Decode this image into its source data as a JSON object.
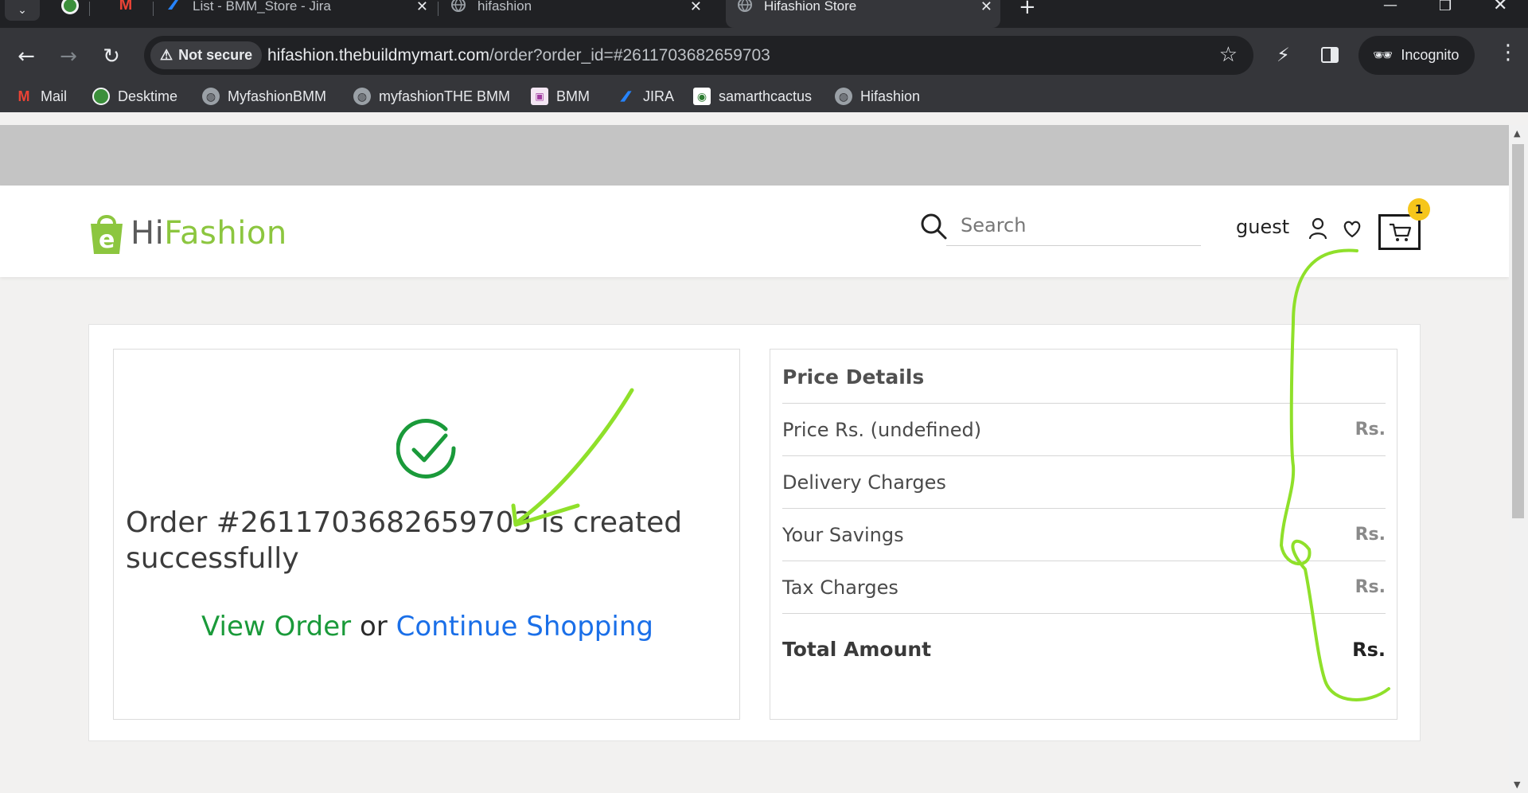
{
  "browser": {
    "tabs": [
      {
        "title": "List - BMM_Store - Jira"
      },
      {
        "title": "hifashion"
      },
      {
        "title": "Hifashion Store",
        "active": true
      }
    ],
    "address": {
      "security_chip": "Not secure",
      "host": "hifashion.thebuildmymart.com",
      "path": "/order?order_id=#2611703682659703"
    },
    "profile_label": "Incognito",
    "bookmarks": [
      {
        "label": "Mail",
        "icon": "gmail-icon"
      },
      {
        "label": "Desktime",
        "icon": "desktime-icon"
      },
      {
        "label": "MyfashionBMM",
        "icon": "globe-icon"
      },
      {
        "label": "myfashionTHE BMM",
        "icon": "globe-icon"
      },
      {
        "label": "BMM",
        "icon": "bmm-icon"
      },
      {
        "label": "JIRA",
        "icon": "jira-icon"
      },
      {
        "label": "samarthcactus",
        "icon": "samarth-icon"
      },
      {
        "label": "Hifashion",
        "icon": "globe-icon"
      }
    ]
  },
  "header": {
    "logo_hi": "Hi",
    "logo_fashion": "Fashion",
    "search_placeholder": "Search",
    "user_label": "guest",
    "cart_count": "1"
  },
  "order": {
    "message": "Order #2611703682659703 is created successfully",
    "view_order": "View Order",
    "or": "or",
    "continue_shopping": "Continue Shopping"
  },
  "price_details": {
    "title": "Price Details",
    "rows": [
      {
        "label": "Price Rs. (undefined)",
        "value": "Rs."
      },
      {
        "label": "Delivery Charges",
        "value": ""
      },
      {
        "label": "Your Savings",
        "value": "Rs."
      },
      {
        "label": "Tax Charges",
        "value": "Rs."
      }
    ],
    "total_label": "Total Amount",
    "total_value": "Rs."
  },
  "colors": {
    "brand_green": "#8cc63f",
    "success_green": "#1a9a3a",
    "link_blue": "#1a6fe8",
    "annotation_green": "#8fe02a"
  }
}
